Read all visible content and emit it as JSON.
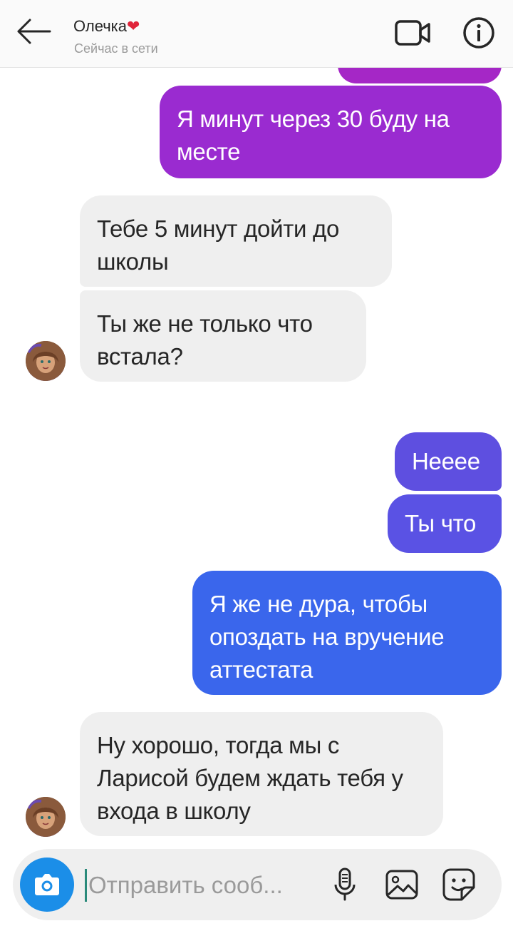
{
  "header": {
    "contact_name": "Олечка",
    "heart": "❤",
    "status": "Сейчас в сети",
    "icons": {
      "back": "back-arrow-icon",
      "video": "video-camera-icon",
      "info": "info-icon"
    }
  },
  "messages": [
    {
      "side": "out",
      "text": "Я минут через 30 буду на месте",
      "color": "#9a2bd0"
    },
    {
      "side": "in",
      "text": "Тебе 5 минут дойти до школы"
    },
    {
      "side": "in",
      "text": "Ты же не только что встала?"
    },
    {
      "side": "out",
      "text": "Нееее",
      "color": "#5e4fe0"
    },
    {
      "side": "out",
      "text": "Ты что",
      "color": "#5a52e4"
    },
    {
      "side": "out",
      "text": "Я же не дура, чтобы опоздать на вручение аттестата",
      "color": "#3a66ec"
    },
    {
      "side": "in",
      "text": "Ну хорошо, тогда мы с Ларисой будем ждать тебя у входа в школу"
    }
  ],
  "composer": {
    "placeholder": "Отправить сооб...",
    "icons": {
      "camera": "camera-icon",
      "mic": "microphone-icon",
      "gallery": "image-gallery-icon",
      "sticker": "sticker-icon"
    }
  },
  "colors": {
    "incoming_bubble": "#efefef",
    "gradient_top": "#a126c4",
    "gradient_bottom": "#2f6bea",
    "camera_button": "#1b8ee8"
  }
}
